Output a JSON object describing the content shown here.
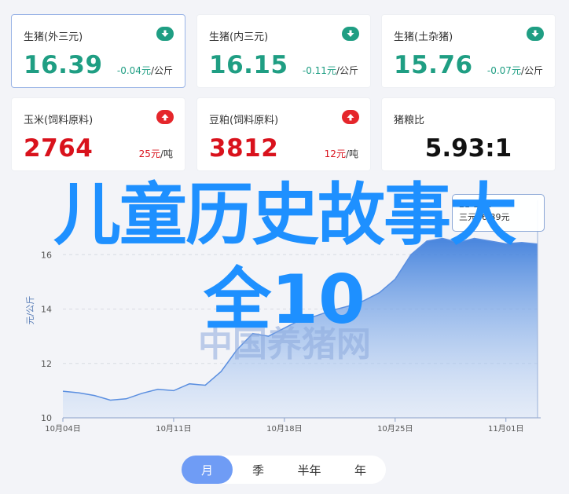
{
  "cards": [
    {
      "label": "生猪(外三元)",
      "price": "16.39",
      "change": "-0.04元",
      "unit": "/公斤",
      "trend": "down",
      "selected": true
    },
    {
      "label": "生猪(内三元)",
      "price": "16.15",
      "change": "-0.11元",
      "unit": "/公斤",
      "trend": "down"
    },
    {
      "label": "生猪(土杂猪)",
      "price": "15.76",
      "change": "-0.07元",
      "unit": "/公斤",
      "trend": "down"
    },
    {
      "label": "玉米(饲料原料)",
      "price": "2764",
      "change": "25元",
      "unit": "/吨",
      "trend": "up"
    },
    {
      "label": "豆粕(饲料原料)",
      "price": "3812",
      "change": "12元",
      "unit": "/吨",
      "trend": "up"
    }
  ],
  "ratio_card": {
    "label": "猪粮比",
    "value": "5.93:1"
  },
  "overlay": {
    "line1": "儿童历史故事大",
    "line2": "全10"
  },
  "watermark": "中国养猪网",
  "tooltip": {
    "line1": "21-11-0",
    "line2": "三元16.39元"
  },
  "tabs": [
    {
      "label": "月",
      "active": true
    },
    {
      "label": "季"
    },
    {
      "label": "半年"
    },
    {
      "label": "年"
    }
  ],
  "chart_data": {
    "type": "area",
    "ylabel": "元/公斤",
    "ylim": [
      10,
      18
    ],
    "yticks": [
      10,
      12,
      14,
      16
    ],
    "xticks": [
      {
        "label": "10月04日",
        "day": 4
      },
      {
        "label": "10月11日",
        "day": 11
      },
      {
        "label": "10月18日",
        "day": 18
      },
      {
        "label": "10月25日",
        "day": 25
      },
      {
        "label": "11月01日",
        "day": 32
      }
    ],
    "series": [
      {
        "x": [
          4,
          5,
          6,
          7,
          8,
          9,
          10,
          11,
          12,
          13,
          14,
          15,
          16,
          17,
          18,
          19,
          20,
          21,
          22,
          23,
          24,
          25,
          26,
          27,
          28,
          29,
          30,
          31,
          32,
          33,
          34
        ],
        "y": [
          10.98,
          10.92,
          10.82,
          10.65,
          10.7,
          10.9,
          11.05,
          11.0,
          11.25,
          11.2,
          11.7,
          12.5,
          13.1,
          13.0,
          13.3,
          13.6,
          13.75,
          13.95,
          14.1,
          14.3,
          14.6,
          15.1,
          16.0,
          16.5,
          16.6,
          16.45,
          16.6,
          16.5,
          16.4,
          16.45,
          16.39
        ]
      }
    ],
    "grid": true,
    "color": "#5b8fe0"
  }
}
